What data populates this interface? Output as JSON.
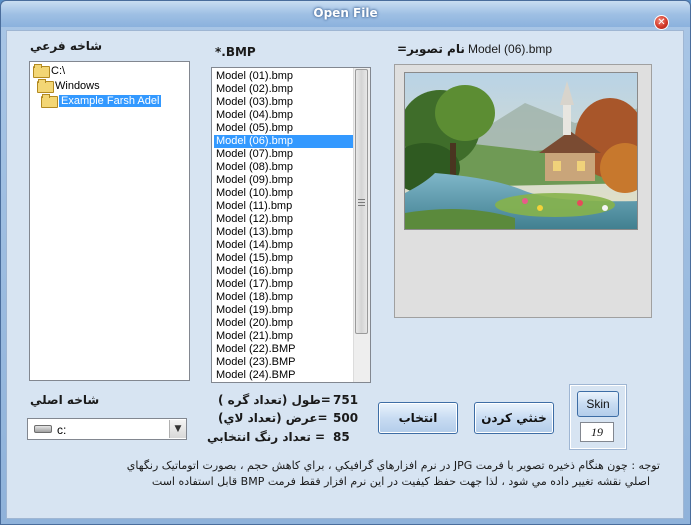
{
  "window": {
    "title": "Open File",
    "close_glyph": "✕"
  },
  "labels": {
    "subfolder": "شاخه فرعي",
    "file_filter": "*.BMP",
    "image_name_label": "نام تصوير=",
    "image_name_value": "Model (06).bmp",
    "main_folder": "شاخه اصلي"
  },
  "tree": {
    "items": [
      {
        "label": "C:\\",
        "icon": "folder-open-icon",
        "selected": false
      },
      {
        "label": "Windows",
        "icon": "folder-open-icon",
        "selected": false
      },
      {
        "label": "Example Farsh Adel",
        "icon": "folder-open-icon",
        "selected": true
      }
    ]
  },
  "files": {
    "items": [
      "Model (01).bmp",
      "Model (02).bmp",
      "Model (03).bmp",
      "Model (04).bmp",
      "Model (05).bmp",
      "Model (06).bmp",
      "Model (07).bmp",
      "Model (08).bmp",
      "Model (09).bmp",
      "Model (10).bmp",
      "Model (11).bmp",
      "Model (12).bmp",
      "Model (13).bmp",
      "Model (14).bmp",
      "Model (15).bmp",
      "Model (16).bmp",
      "Model (17).bmp",
      "Model (18).bmp",
      "Model (19).bmp",
      "Model (20).bmp",
      "Model (21).bmp",
      "Model (22).BMP",
      "Model (23).BMP",
      "Model (24).BMP"
    ],
    "selected_index": 5
  },
  "drive": {
    "value": "c:",
    "icon": "drive-icon"
  },
  "stats": {
    "length_value": "751",
    "length_label": "=طول (تعداد گره )",
    "width_value": "500",
    "width_label": "=عرض (تعداد لاي)",
    "colors_value": "85",
    "colors_label": "= تعداد رنگ انتخابي"
  },
  "buttons": {
    "select": "انتخاب",
    "cancel": "خنثي کردن",
    "skin": "Skin",
    "skin_number": "19"
  },
  "note": {
    "line1": "توجه : چون هنگام ذخيره تصوير با فرمت  JPG  در نرم افزارهاي گرافيکي ، براي کاهش حجم ، بصورت اتوماتيک رنگهاي",
    "line2": "اصلي نقشه تغيير داده مي شود ، لذا جهت حفظ کيفيت در اين نرم افزار فقط فرمت BMP قابل استفاده است"
  },
  "colors": {
    "selection": "#3399ff",
    "window_bg": "#d7e4f2"
  }
}
